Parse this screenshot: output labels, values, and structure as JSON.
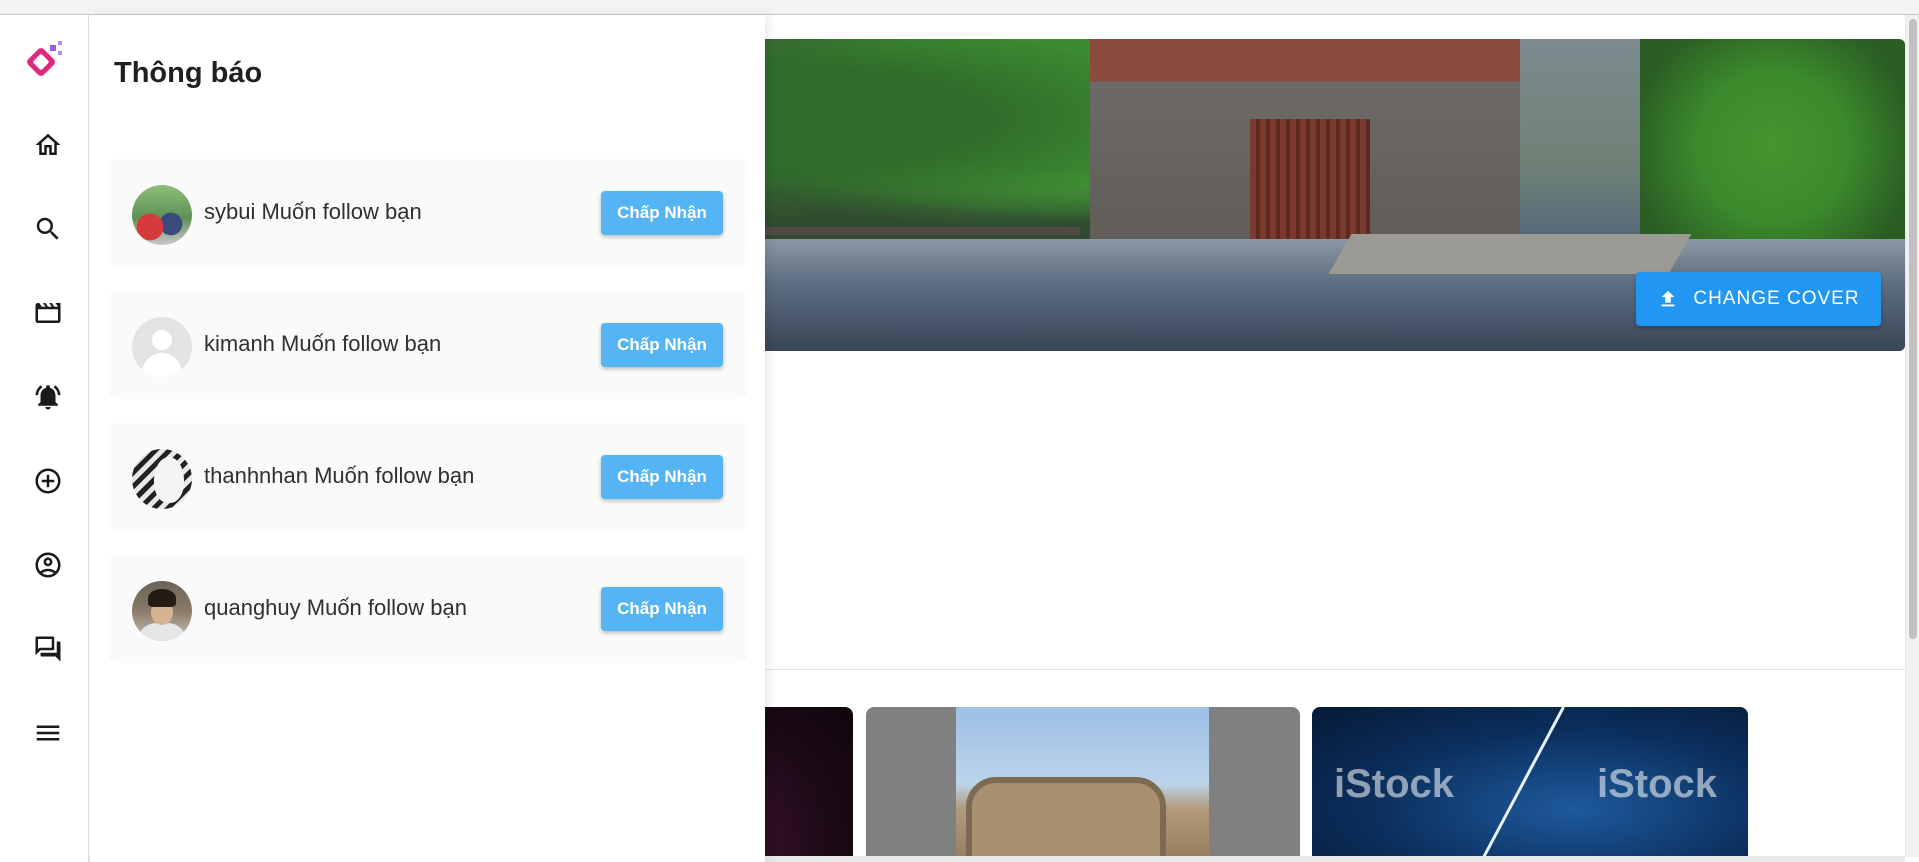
{
  "drawer": {
    "title": "Thông báo",
    "notifications": [
      {
        "username": "sybui",
        "text": "sybui Muốn follow bạn",
        "accept_label": "Chấp Nhận"
      },
      {
        "username": "kimanh",
        "text": "kimanh Muốn follow bạn",
        "accept_label": "Chấp Nhận"
      },
      {
        "username": "thanhnhan",
        "text": "thanhnhan Muốn follow bạn",
        "accept_label": "Chấp Nhận"
      },
      {
        "username": "quanghuy",
        "text": "quanghuy Muốn follow bạn",
        "accept_label": "Chấp Nhận"
      }
    ]
  },
  "rail": {
    "items": [
      {
        "icon": "home-icon"
      },
      {
        "icon": "search-icon"
      },
      {
        "icon": "reels-icon"
      },
      {
        "icon": "notifications-icon"
      },
      {
        "icon": "add-circle-icon"
      },
      {
        "icon": "account-circle-icon"
      },
      {
        "icon": "chat-icon"
      },
      {
        "icon": "menu-icon"
      }
    ]
  },
  "profile": {
    "change_cover_label": "CHANGE COVER",
    "post_watermark": "iStock"
  },
  "colors": {
    "accent": "#2196f3",
    "accept_button": "#55b5f4",
    "logo_primary": "#e0267d",
    "logo_secondary": "#9b5de5"
  }
}
